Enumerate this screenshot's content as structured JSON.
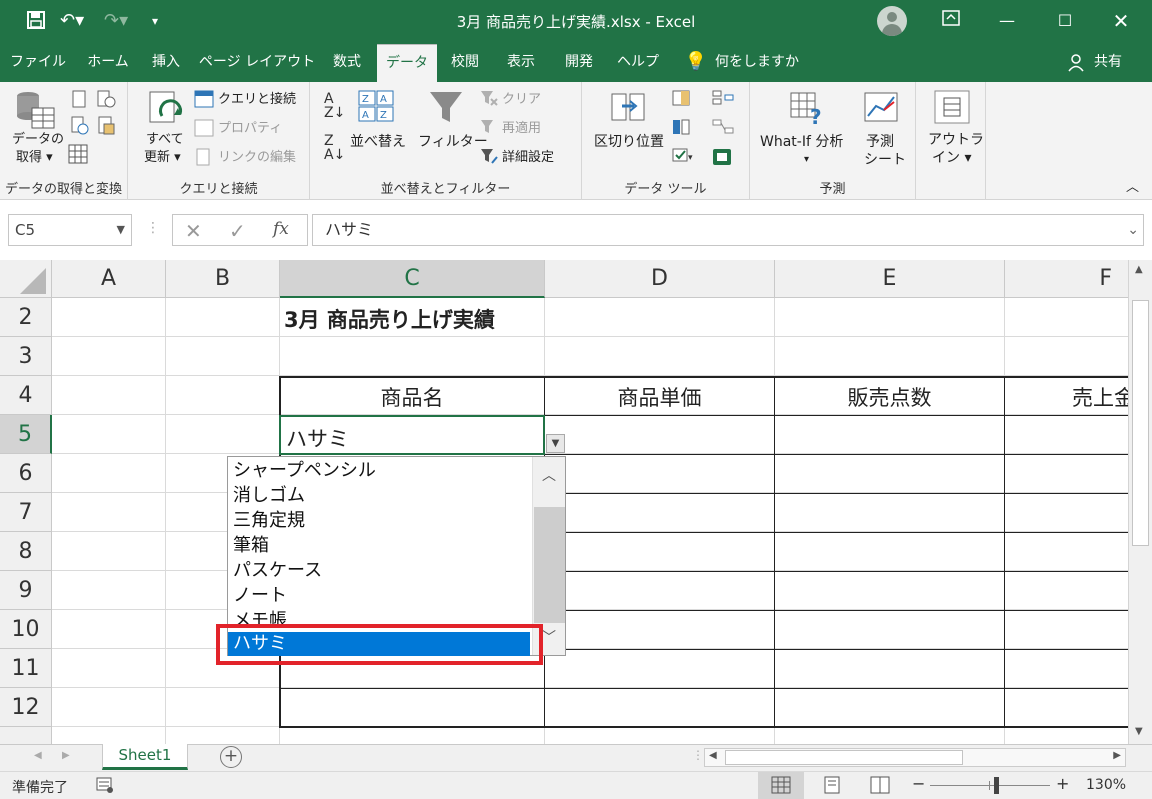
{
  "titlebar": {
    "title": "3月 商品売り上げ実績.xlsx  -  Excel",
    "accent": "#217346"
  },
  "tabs": [
    {
      "label": "ファイル"
    },
    {
      "label": "ホーム"
    },
    {
      "label": "挿入"
    },
    {
      "label": "ページ レイアウト"
    },
    {
      "label": "数式"
    },
    {
      "label": "データ"
    },
    {
      "label": "校閲"
    },
    {
      "label": "表示"
    },
    {
      "label": "開発"
    },
    {
      "label": "ヘルプ"
    },
    {
      "label": "何をしますか"
    },
    {
      "label": "共有"
    }
  ],
  "ribbon": {
    "get_data": {
      "line1": "データの",
      "line2": "取得",
      "group": "データの取得と変換"
    },
    "queries": {
      "refresh_line1": "すべて",
      "refresh_line2": "更新",
      "queries_connections": "クエリと接続",
      "properties": "プロパティ",
      "edit_links": "リンクの編集",
      "group": "クエリと接続"
    },
    "sort_filter": {
      "sort": "並べ替え",
      "filter": "フィルター",
      "clear": "クリア",
      "reapply": "再適用",
      "advanced": "詳細設定",
      "group": "並べ替えとフィルター"
    },
    "data_tools": {
      "text_to_columns": "区切り位置",
      "group": "データ ツール"
    },
    "forecast": {
      "whatif": "What-If 分析",
      "forecast_line1": "予測",
      "forecast_line2": "シート",
      "group": "予測"
    },
    "outline": {
      "line1": "アウトラ",
      "line2": "イン"
    }
  },
  "formula_bar": {
    "name_box": "C5",
    "formula": "ハサミ"
  },
  "sheet": {
    "columns": [
      "A",
      "B",
      "C",
      "D",
      "E",
      "F"
    ],
    "rows": [
      "2",
      "3",
      "4",
      "5",
      "6",
      "7",
      "8",
      "9",
      "10",
      "11",
      "12"
    ],
    "cells": {
      "c2": "3月 商品売り上げ実績",
      "c4": "商品名",
      "d4": "商品単価",
      "e4": "販売点数",
      "f4": "売上金",
      "c5": "ハサミ"
    }
  },
  "dropdown": {
    "items": [
      "シャープペンシル",
      "消しゴム",
      "三角定規",
      "筆箱",
      "パスケース",
      "ノート",
      "メモ帳",
      "ハサミ"
    ],
    "selected": "ハサミ",
    "highlight_color": "#e2232a"
  },
  "sheet_tabs": [
    "Sheet1"
  ],
  "status": {
    "ready": "準備完了",
    "zoom": "130%"
  }
}
